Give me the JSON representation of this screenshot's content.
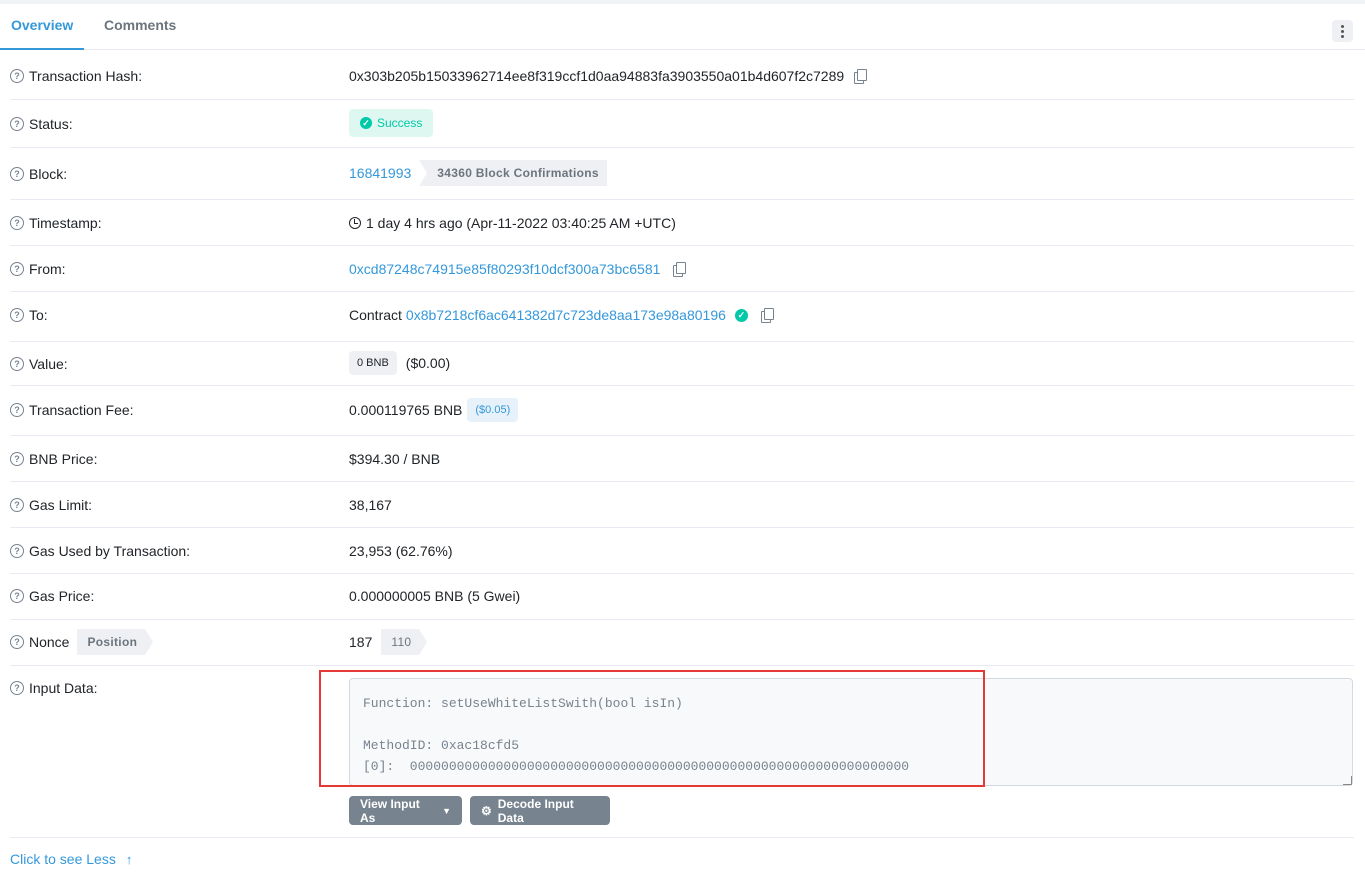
{
  "tabs": [
    {
      "label": "Overview",
      "active": true
    },
    {
      "label": "Comments",
      "active": false
    }
  ],
  "menu_icon": "kebab-vertical-icon",
  "rows": {
    "tx_hash": {
      "label": "Transaction Hash:",
      "value": "0x303b205b15033962714ee8f319ccf1d0aa94883fa3903550a01b4d607f2c7289"
    },
    "status": {
      "label": "Status:",
      "value": "Success"
    },
    "block": {
      "label": "Block:",
      "value": "16841993",
      "confirmations": "34360 Block Confirmations"
    },
    "timestamp": {
      "label": "Timestamp:",
      "value": "1 day 4 hrs ago (Apr-11-2022 03:40:25 AM +UTC)"
    },
    "from": {
      "label": "From:",
      "value": "0xcd87248c74915e85f80293f10dcf300a73bc6581"
    },
    "to": {
      "label": "To:",
      "prefix": "Contract",
      "value": "0x8b7218cf6ac641382d7c723de8aa173e98a80196"
    },
    "value": {
      "label": "Value:",
      "amount": "0 BNB",
      "usd": "($0.00)"
    },
    "fee": {
      "label": "Transaction Fee:",
      "amount": "0.000119765 BNB",
      "usd": "($0.05)"
    },
    "bnb_price": {
      "label": "BNB Price:",
      "value": "$394.30 / BNB"
    },
    "gas_limit": {
      "label": "Gas Limit:",
      "value": "38,167"
    },
    "gas_used": {
      "label": "Gas Used by Transaction:",
      "value": "23,953 (62.76%)"
    },
    "gas_price": {
      "label": "Gas Price:",
      "value": "0.000000005 BNB (5 Gwei)"
    },
    "nonce": {
      "label": "Nonce",
      "position_label": "Position",
      "value": "187",
      "position": "110"
    },
    "input": {
      "label": "Input Data:",
      "text": "Function: setUseWhiteListSwith(bool isIn)\n\nMethodID: 0xac18cfd5\n[0]:  0000000000000000000000000000000000000000000000000000000000000000",
      "view_button": "View Input As",
      "decode_button": "Decode Input Data"
    }
  },
  "see_less": "Click to see Less",
  "colors": {
    "accent": "#3498db",
    "success": "#00c9a7",
    "highlight": "#e53935"
  }
}
